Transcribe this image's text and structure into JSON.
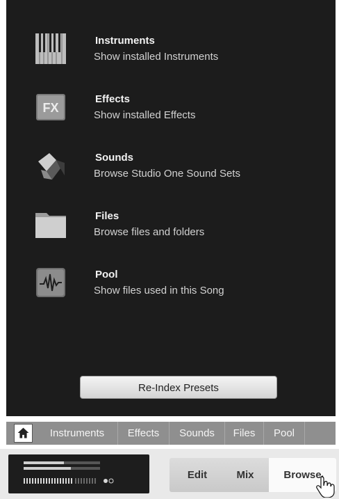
{
  "items": [
    {
      "title": "Instruments",
      "subtitle": "Show installed Instruments",
      "icon": "piano-keys-icon"
    },
    {
      "title": "Effects",
      "subtitle": "Show installed Effects",
      "icon": "fx-icon"
    },
    {
      "title": "Sounds",
      "subtitle": "Browse Studio One Sound Sets",
      "icon": "sound-cubes-icon"
    },
    {
      "title": "Files",
      "subtitle": "Browse files and folders",
      "icon": "folder-icon"
    },
    {
      "title": "Pool",
      "subtitle": "Show files used in this Song",
      "icon": "waveform-icon"
    }
  ],
  "reindex_label": "Re-Index Presets",
  "tabs": [
    "Instruments",
    "Effects",
    "Sounds",
    "Files",
    "Pool"
  ],
  "view_buttons": [
    "Edit",
    "Mix",
    "Browse"
  ],
  "active_view": "Browse",
  "colors": {
    "panel": "#1c1c1c",
    "tabbar": "#8f8f8f"
  }
}
